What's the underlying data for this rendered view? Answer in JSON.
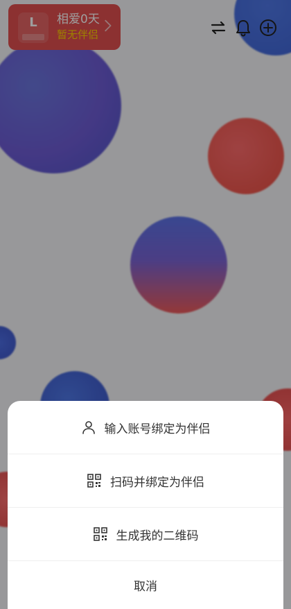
{
  "header": {
    "avatar_initial": "L",
    "days_text": "相爱0天",
    "partner_status": "暂无伴侣",
    "icons": [
      "swap-icon",
      "bell-icon",
      "add-circle-icon"
    ]
  },
  "sheet": {
    "options": [
      {
        "label": "输入账号绑定为伴侣",
        "icon": "user-icon"
      },
      {
        "label": "扫码并绑定为伴侣",
        "icon": "qr-code-icon"
      },
      {
        "label": "生成我的二维码",
        "icon": "qr-code-icon"
      }
    ],
    "cancel_label": "取消"
  },
  "colors": {
    "card_bg": "#e25050",
    "partner_text": "#ffd200",
    "sheet_bg": "#ffffff",
    "overlay": "rgba(0,0,0,0.38)"
  }
}
